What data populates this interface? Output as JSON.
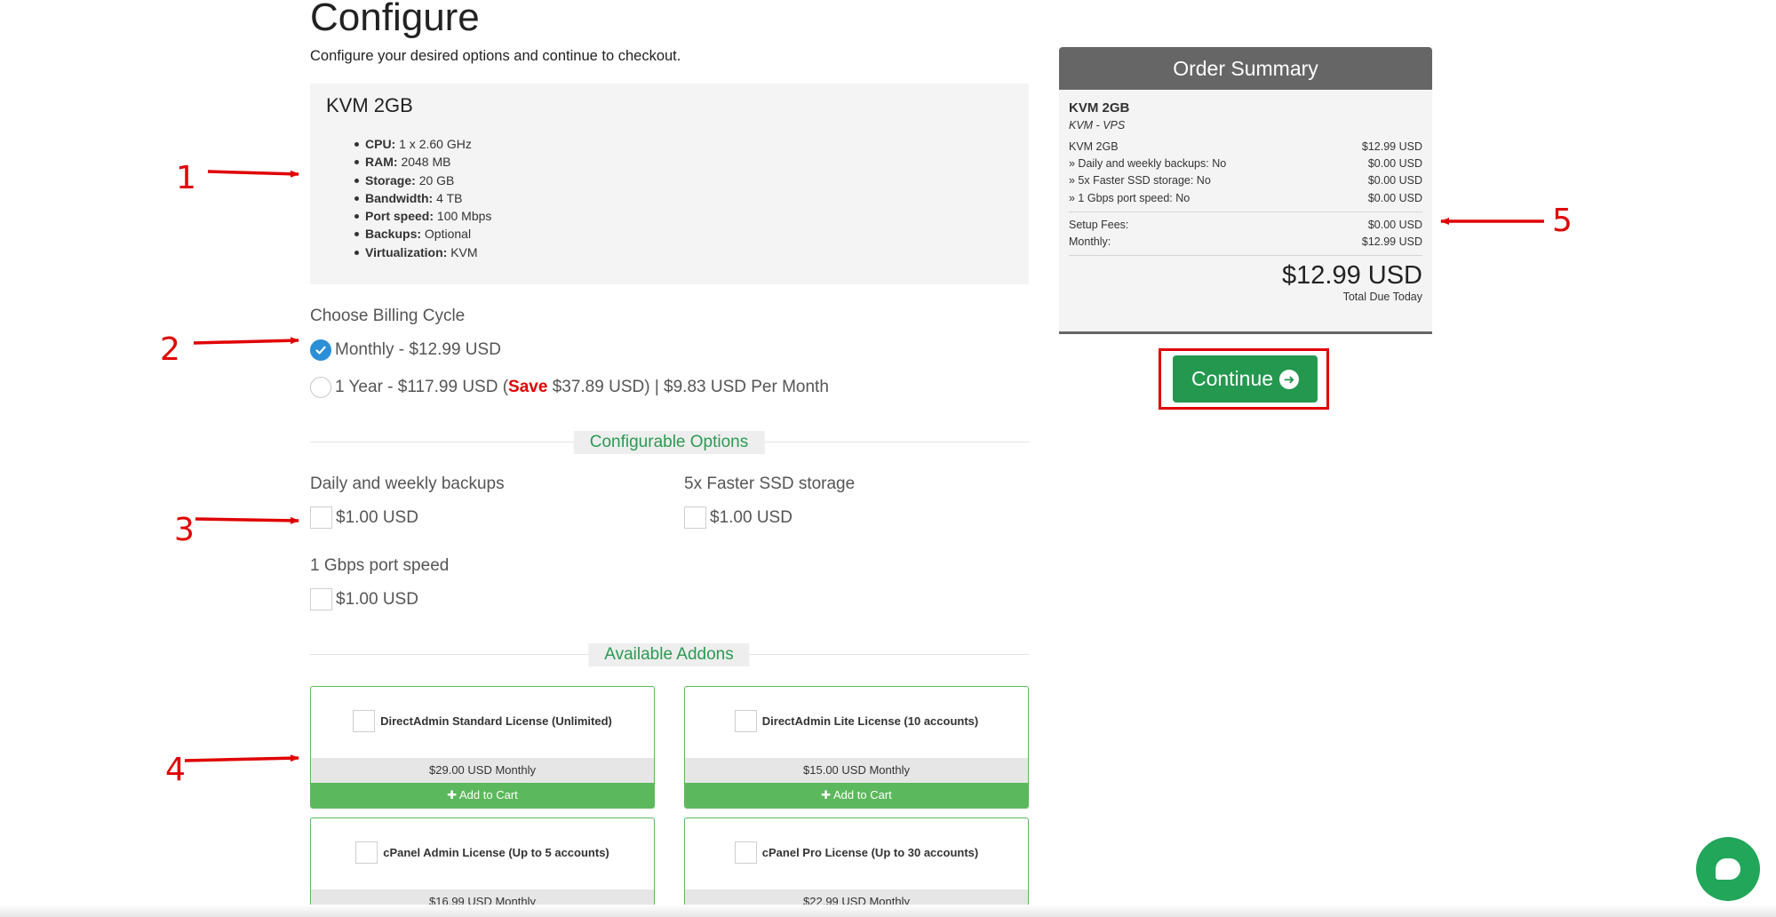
{
  "header": {
    "title": "Configure",
    "subtitle": "Configure your desired options and continue to checkout."
  },
  "product": {
    "name": "KVM 2GB",
    "specs": [
      {
        "key": "CPU:",
        "value": "1 x 2.60 GHz"
      },
      {
        "key": "RAM:",
        "value": "2048 MB"
      },
      {
        "key": "Storage:",
        "value": "20 GB"
      },
      {
        "key": "Bandwidth:",
        "value": "4 TB"
      },
      {
        "key": "Port speed:",
        "value": "100 Mbps"
      },
      {
        "key": "Backups:",
        "value": "Optional"
      },
      {
        "key": "Virtualization:",
        "value": "KVM"
      }
    ]
  },
  "billing": {
    "label": "Choose Billing Cycle",
    "monthly": {
      "text": "Monthly - $12.99 USD",
      "checked": true
    },
    "yearly": {
      "prefix": "1 Year - $117.99 USD (",
      "save": "Save",
      "suffix": " $37.89 USD) | $9.83 USD Per Month",
      "checked": false
    }
  },
  "configurable": {
    "heading": "Configurable Options",
    "options": [
      {
        "label": "Daily and weekly backups",
        "price": "$1.00 USD"
      },
      {
        "label": "5x Faster SSD storage",
        "price": "$1.00 USD"
      },
      {
        "label": "1 Gbps port speed",
        "price": "$1.00 USD"
      }
    ]
  },
  "addons": {
    "heading": "Available Addons",
    "add_label": "Add to Cart",
    "items": [
      {
        "name": "DirectAdmin Standard License (Unlimited)",
        "price": "$29.00 USD Monthly"
      },
      {
        "name": "DirectAdmin Lite License (10 accounts)",
        "price": "$15.00 USD Monthly"
      },
      {
        "name": "cPanel Admin License (Up to 5 accounts)",
        "price": "$16.99 USD Monthly"
      },
      {
        "name": "cPanel Pro License (Up to 30 accounts)",
        "price": "$22.99 USD Monthly"
      }
    ]
  },
  "summary": {
    "heading": "Order Summary",
    "product": "KVM 2GB",
    "group": "KVM - VPS",
    "lines": [
      {
        "label": "KVM 2GB",
        "amount": "$12.99 USD"
      },
      {
        "label": "» Daily and weekly backups: No",
        "amount": "$0.00 USD"
      },
      {
        "label": "» 5x Faster SSD storage: No",
        "amount": "$0.00 USD"
      },
      {
        "label": "» 1 Gbps port speed: No",
        "amount": "$0.00 USD"
      }
    ],
    "fees": [
      {
        "label": "Setup Fees:",
        "amount": "$0.00 USD"
      },
      {
        "label": "Monthly:",
        "amount": "$12.99 USD"
      }
    ],
    "total": "$12.99 USD",
    "total_label": "Total Due Today"
  },
  "continue_label": "Continue",
  "annotations": [
    "1",
    "2",
    "3",
    "4",
    "5"
  ],
  "colors": {
    "accent_green": "#24984f",
    "addon_green": "#5cb85c",
    "annotation_red": "#e00000",
    "radio_blue": "#2a8fd6",
    "summary_header": "#666666"
  },
  "icons": {
    "checkmark": "check-icon",
    "plus": "plus-icon",
    "continue": "arrow-circle-right-icon",
    "chat": "chat-icon"
  }
}
